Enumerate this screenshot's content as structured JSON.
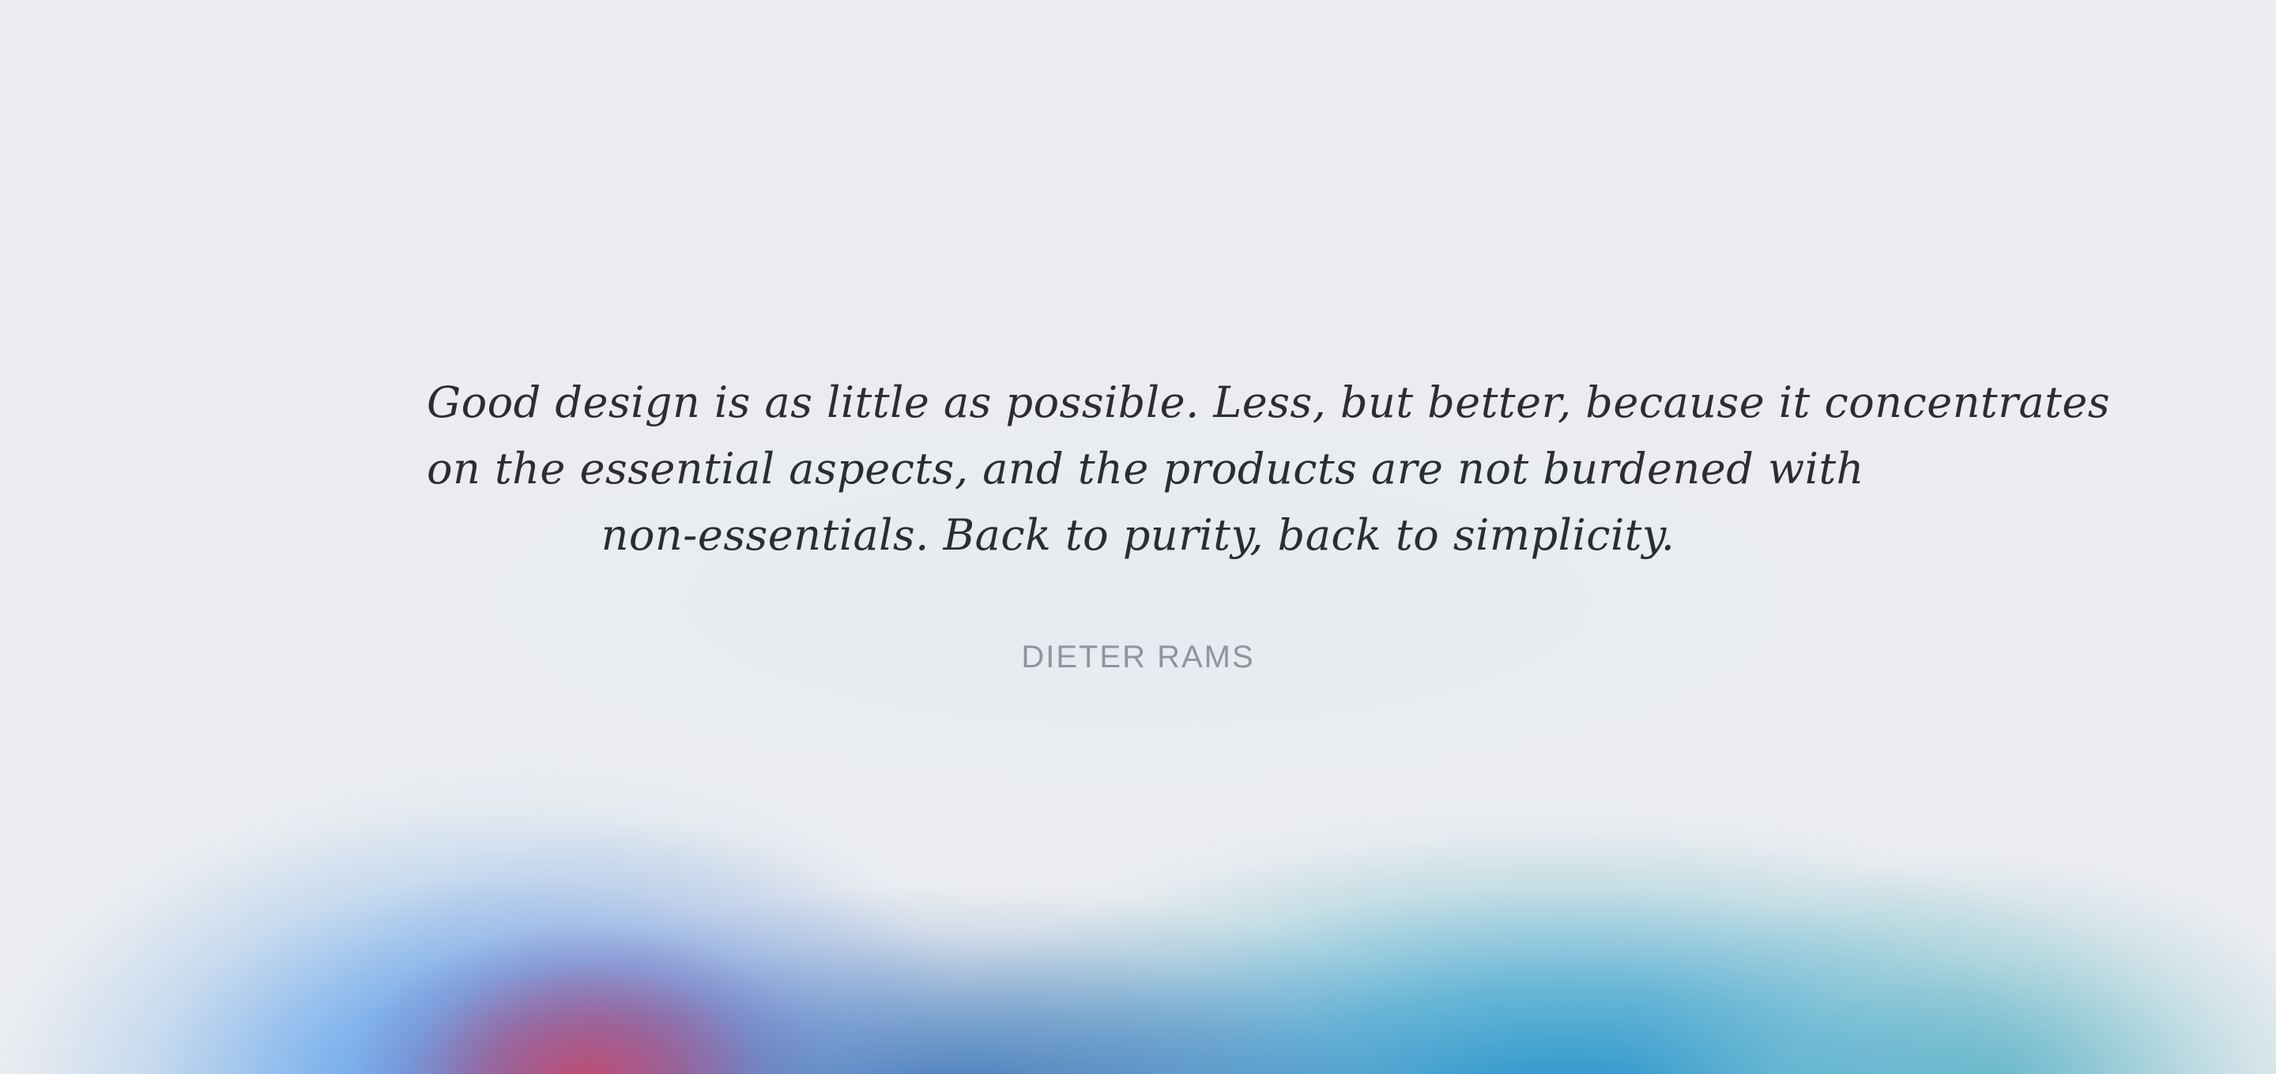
{
  "quote": {
    "lines": [
      "Good design is as little as possible. Less, but better, because it concentrates",
      "on the essential aspects, and the products are not burdened with",
      "non-essentials. Back to purity, back to simplicity."
    ],
    "author": "DIETER RAMS"
  },
  "colors": {
    "background": "#ecedf0",
    "quote_text": "#2c2d33",
    "author_text": "#92949c",
    "glow_blue": "#4d96ea",
    "glow_teal": "#1a8cc8",
    "glow_magenta": "#c4486c"
  }
}
